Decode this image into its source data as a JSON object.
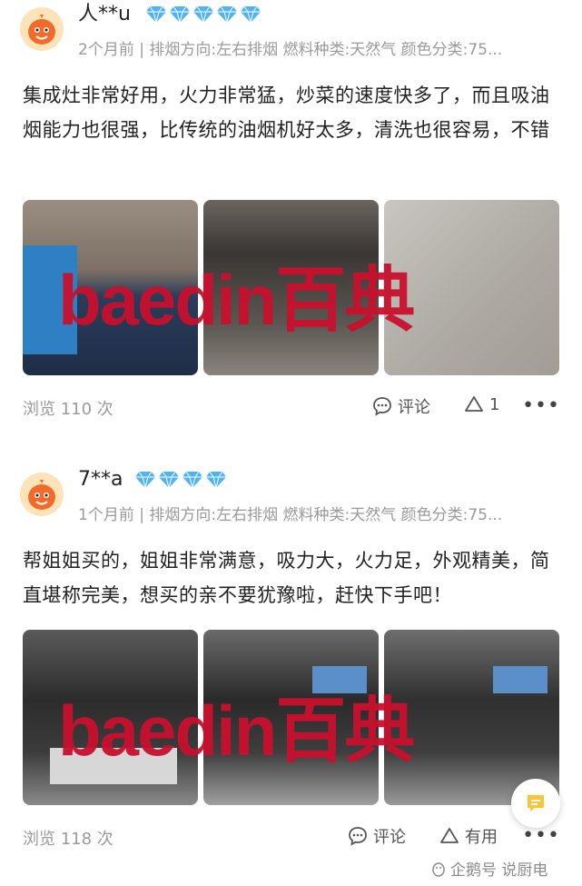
{
  "reviews": [
    {
      "username": "人**u",
      "gem_count": 5,
      "meta": "2个月前 | 排烟方向:左右排烟 燃料种类:天然气 颜色分类:75...",
      "content": "集成灶非常好用，火力非常猛，炒菜的速度快多了，而且吸油烟能力也很强，比传统的油烟机好太多，清洗也很容易，不错",
      "views": "浏览 110 次",
      "comment_label": "评论",
      "like_label": "1",
      "more_label": "•••",
      "watermark": "baedin百典"
    },
    {
      "username": "7**a",
      "gem_count": 4,
      "meta": "1个月前 | 排烟方向:左右排烟 燃料种类:天然气 颜色分类:75...",
      "content": "帮姐姐买的，姐姐非常满意，吸力大，火力足，外观精美，简直堪称完美，想买的亲不要犹豫啦，赶快下手吧！",
      "views": "浏览 118 次",
      "comment_label": "评论",
      "like_label": "有用",
      "more_label": "•••",
      "watermark": "baedin百典"
    }
  ],
  "brand": "企鹅号 说厨电",
  "colors": {
    "accent": "#c8102e",
    "gem": "#4fb3f6",
    "meta": "#9a9a9a"
  }
}
